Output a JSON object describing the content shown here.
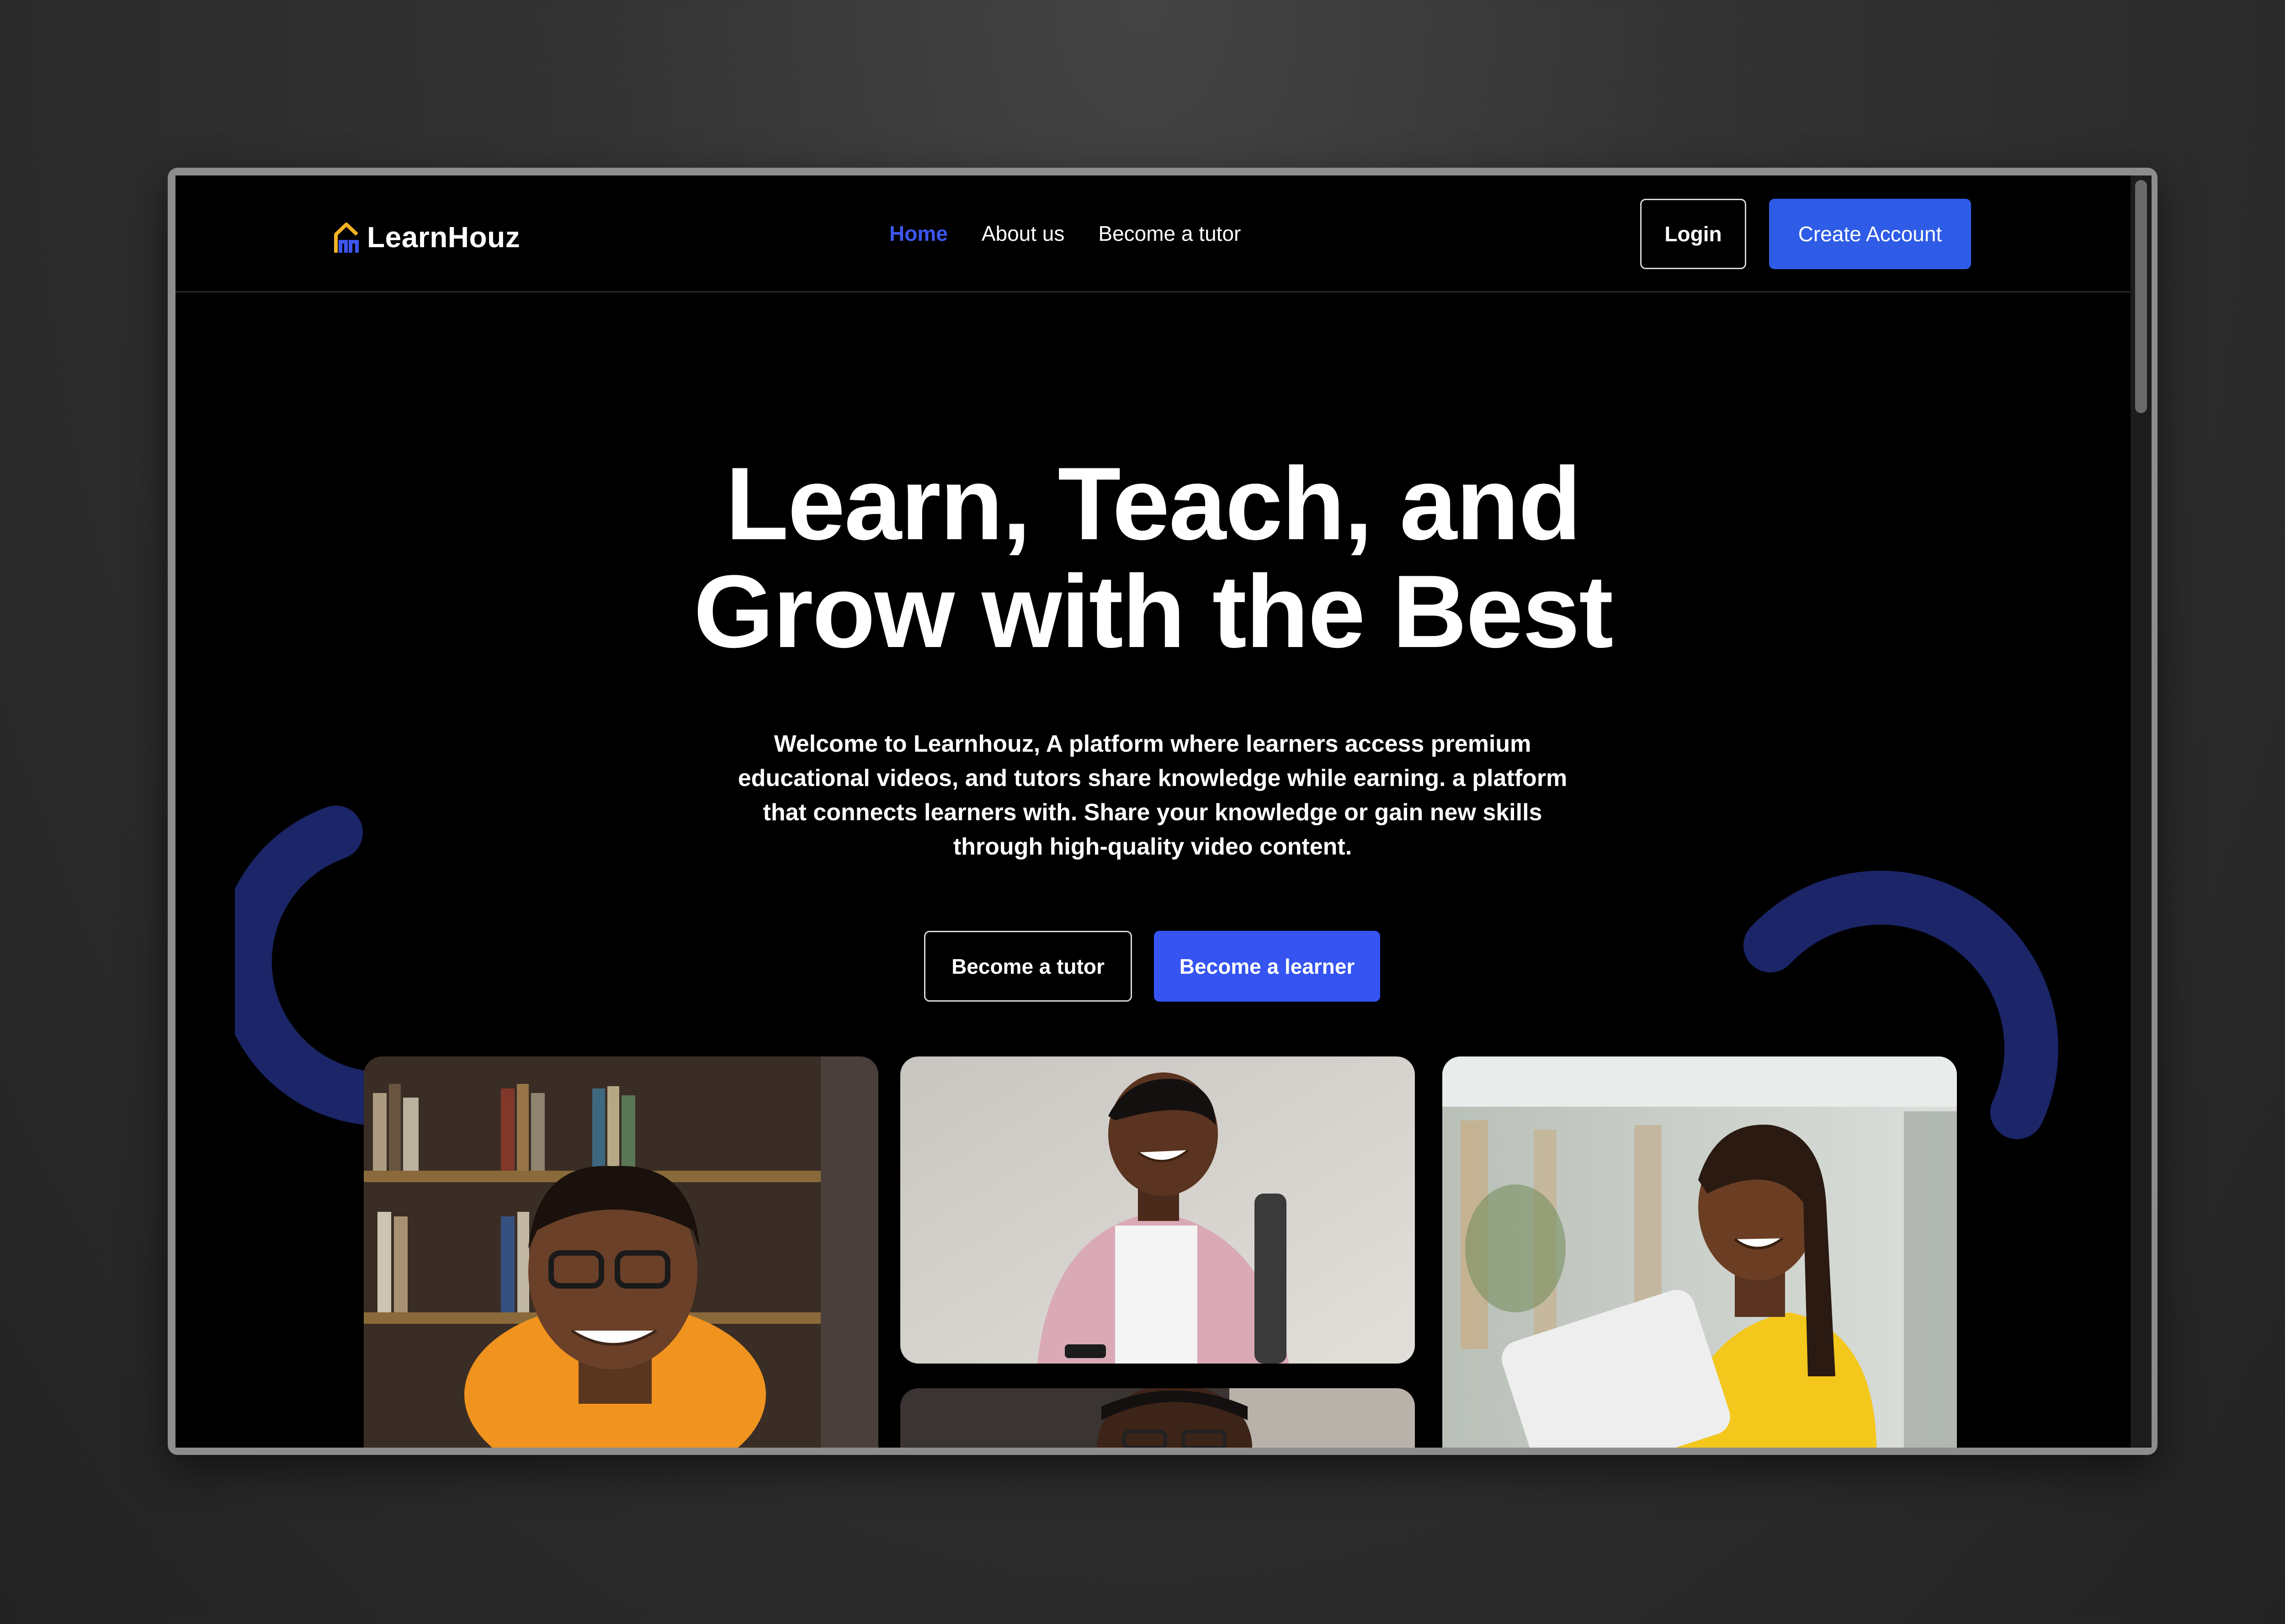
{
  "brand": {
    "name": "LearnHouz"
  },
  "nav": {
    "links": [
      {
        "label": "Home",
        "active": true
      },
      {
        "label": "About us",
        "active": false
      },
      {
        "label": "Become a tutor",
        "active": false
      }
    ],
    "login_label": "Login",
    "create_account_label": "Create Account"
  },
  "hero": {
    "title_line1": "Learn, Teach, and",
    "title_line2": "Grow with the Best",
    "description": "Welcome to Learnhouz, A platform where learners access premium educational videos, and tutors share knowledge while earning. a platform that connects learners with. Share your knowledge or gain new skills through high-quality video content.",
    "cta_tutor_label": "Become a tutor",
    "cta_learner_label": "Become a learner"
  },
  "colors": {
    "accent": "#3d56f0",
    "primary_button": "#2e5ce6",
    "learner_button": "#3554f2",
    "decor_arc": "#1b2567",
    "logo_yellow": "#f5b324",
    "logo_blue": "#3d56f0"
  }
}
